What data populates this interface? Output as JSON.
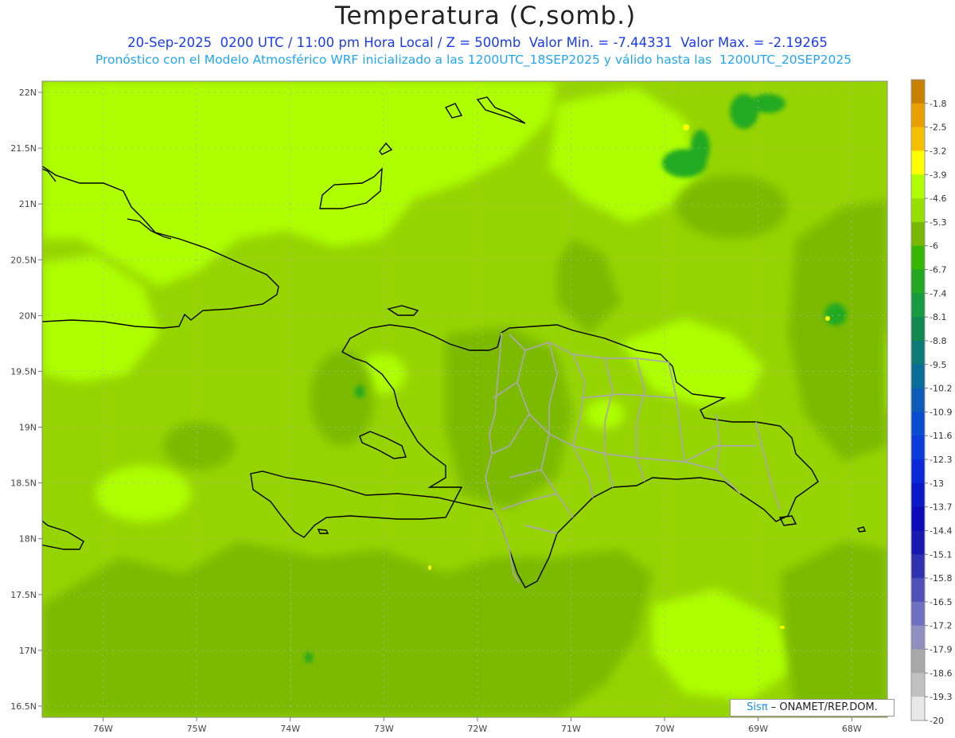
{
  "header": {
    "title": "Temperatura (C,somb.)",
    "line1": "20-Sep-2025  0200 UTC / 11:00 pm Hora Local / Z = 500mb  Valor Min. = -7.44331  Valor Max. = -2.19265",
    "line2": "Pronóstico con el Modelo Atmosférico WRF inicializado a las 1200UTC_18SEP2025 y válido hasta las  1200UTC_20SEP2025"
  },
  "axes": {
    "lat_labels": [
      "22N",
      "21.5N",
      "21N",
      "20.5N",
      "20N",
      "19.5N",
      "19N",
      "18.5N",
      "18N",
      "17.5N",
      "17N",
      "16.5N"
    ],
    "lat_values": [
      22,
      21.5,
      21,
      20.5,
      20,
      19.5,
      19,
      18.5,
      18,
      17.5,
      17,
      16.5
    ],
    "lon_labels": [
      "76W",
      "75W",
      "74W",
      "73W",
      "72W",
      "71W",
      "70W",
      "69W",
      "68W"
    ],
    "lon_values": [
      -76,
      -75,
      -74,
      -73,
      -72,
      -71,
      -70,
      -69,
      -68
    ],
    "lat_range": [
      16.4,
      22.1
    ],
    "lon_range": [
      -76.65,
      -67.62
    ]
  },
  "colorbar": {
    "labels": [
      "-1.8",
      "-2.5",
      "-3.2",
      "-3.9",
      "-4.6",
      "-5.3",
      "-6",
      "-6.7",
      "-7.4",
      "-8.1",
      "-8.8",
      "-9.5",
      "-10.2",
      "-10.9",
      "-11.6",
      "-12.3",
      "-13",
      "-13.7",
      "-14.4",
      "-15.1",
      "-15.8",
      "-16.5",
      "-17.2",
      "-17.9",
      "-18.6",
      "-19.3",
      "-20"
    ],
    "colors": [
      "#c88000",
      "#e8a000",
      "#f5c000",
      "#ffff00",
      "#b0ff00",
      "#96e000",
      "#78b800",
      "#36b800",
      "#22a822",
      "#1a9a40",
      "#128850",
      "#0e7a78",
      "#0a6c98",
      "#0a5cb8",
      "#0a4cd0",
      "#0a3ad8",
      "#0a28d8",
      "#0a18c8",
      "#0a0ab8",
      "#1818b0",
      "#3030b0",
      "#5050b8",
      "#7070c0",
      "#9090c0",
      "#a8a8a8",
      "#c0c0c0",
      "#e8e8e8"
    ]
  },
  "field_colors": {
    "base": "#96d400",
    "light": "#aeff00",
    "dark": "#7cba00",
    "darker": "#22aa22",
    "yellow": "#ffff00"
  },
  "credit": {
    "sis": "Sisπ",
    "org": " – ONAMET/REP.DOM."
  }
}
